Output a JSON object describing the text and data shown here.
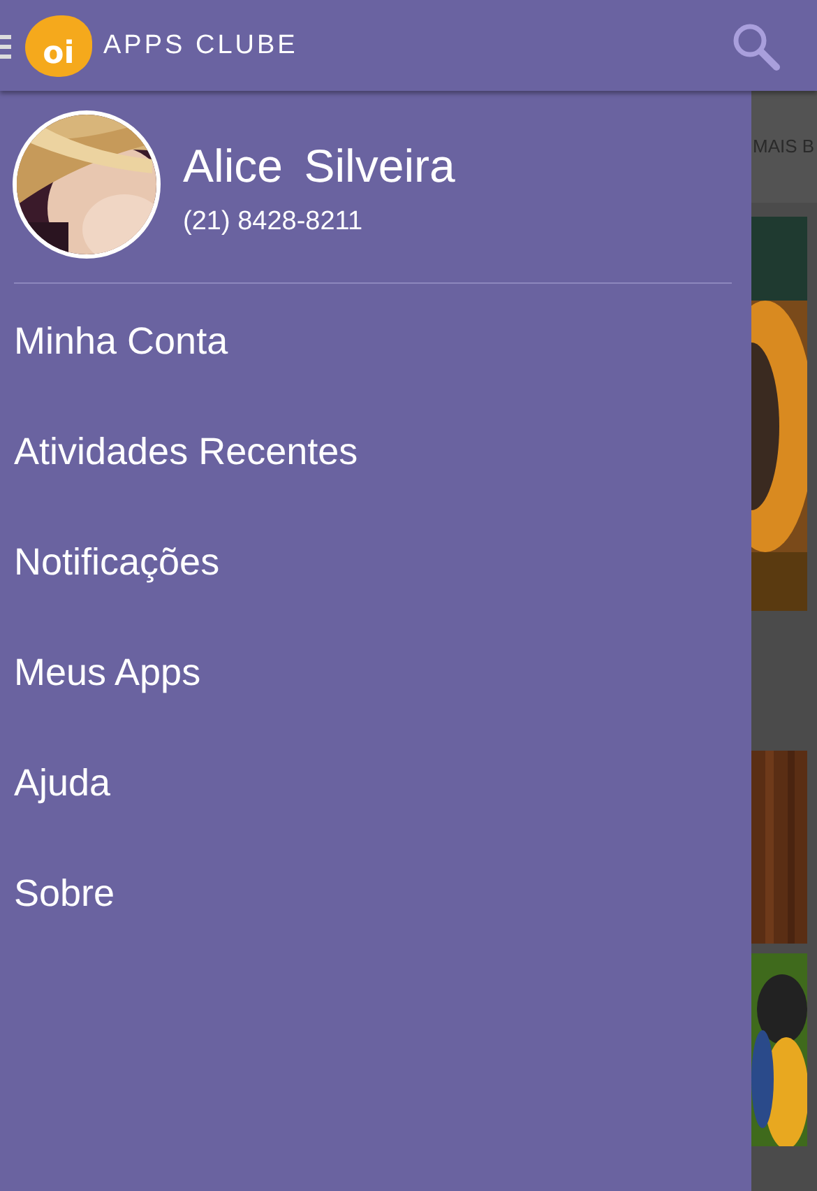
{
  "app_bar": {
    "logo_text": "oi",
    "title": "APPS CLUBE"
  },
  "profile": {
    "name": "Alice Silveira",
    "phone": "(21) 8428-8211"
  },
  "menu": [
    {
      "label": "Minha Conta"
    },
    {
      "label": "Atividades Recentes"
    },
    {
      "label": "Notificações"
    },
    {
      "label": "Meus Apps"
    },
    {
      "label": "Ajuda"
    },
    {
      "label": "Sobre"
    }
  ],
  "background": {
    "tab": "MAIS B"
  }
}
